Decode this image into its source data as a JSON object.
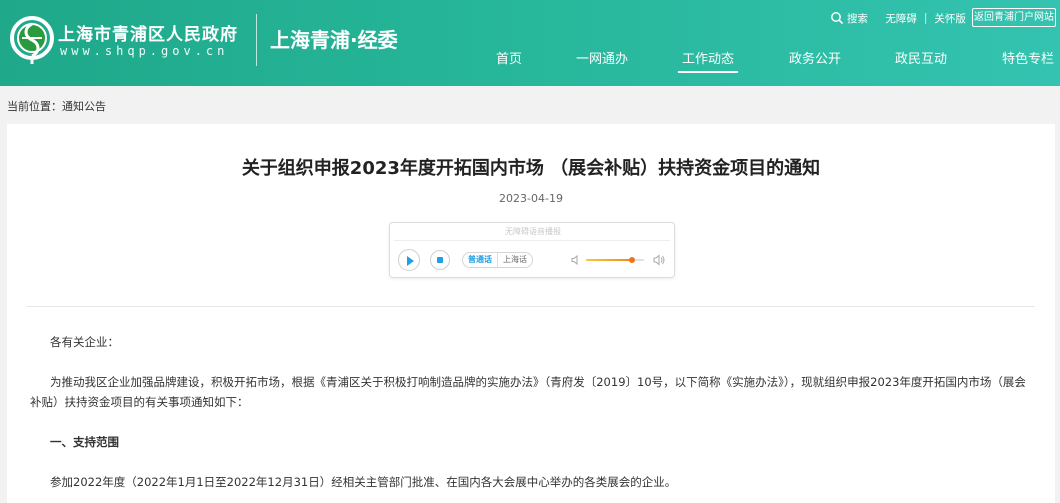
{
  "header": {
    "site_name": "上海市青浦区人民政府",
    "site_domain": "www.shqp.gov.cn",
    "dept_name": "上海青浦·经委",
    "toplinks": {
      "search": "搜索",
      "accessibility": "无障碍",
      "care_mode": "关怀版",
      "portal": "返回青浦门户网站"
    },
    "nav": [
      "首页",
      "一网通办",
      "工作动态",
      "政务公开",
      "政民互动",
      "特色专栏"
    ],
    "nav_active_index": 2,
    "colors": {
      "bar_start": "#1fa88a",
      "bar_end": "#34c3b0"
    }
  },
  "breadcrumb": "当前位置：通知公告",
  "article": {
    "title": "关于组织申报2023年度开拓国内市场 （展会补贴）扶持资金项目的通知",
    "date": "2023-04-19",
    "player": {
      "title": "无障碍语音播报",
      "languages": [
        "普通话",
        "上海话"
      ],
      "active_language": "普通话",
      "play_icon": "play-icon",
      "stop_icon": "stop-icon",
      "volume_level": 0.8,
      "accent": "#1e9fe8"
    },
    "paragraphs": [
      "各有关企业：",
      "为推动我区企业加强品牌建设，积极开拓市场，根据《青浦区关于积极打响制造品牌的实施办法》（青府发〔2019〕10号，以下简称《实施办法》），现就组织申报2023年度开拓国内市场（展会补贴）扶持资金项目的有关事项通知如下：",
      "一、支持范围",
      "参加2022年度（2022年1月1日至2022年12月31日）经相关主管部门批准、在国内各大会展中心举办的各类展会的企业。"
    ]
  }
}
